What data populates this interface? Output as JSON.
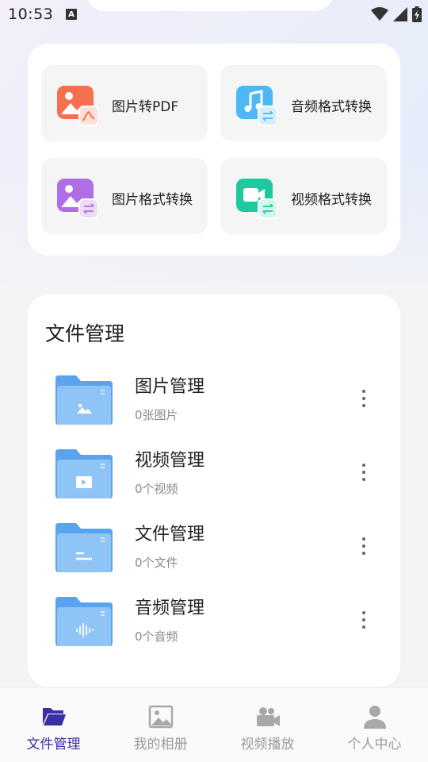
{
  "status_bar": {
    "time": "10:53",
    "notification_badge": "A"
  },
  "colors": {
    "active": "#3a2fa0",
    "inactive": "#a8a8a8",
    "folder_light": "#8fc4f7",
    "folder_dark": "#5aa3ee"
  },
  "tools": [
    {
      "label": "图片转PDF",
      "icon": "image-to-pdf-icon"
    },
    {
      "label": "音频格式转换",
      "icon": "audio-convert-icon"
    },
    {
      "label": "图片格式转换",
      "icon": "image-convert-icon"
    },
    {
      "label": "视频格式转换",
      "icon": "video-convert-icon"
    }
  ],
  "file_section": {
    "title": "文件管理",
    "items": [
      {
        "name": "图片管理",
        "sub": "0张图片",
        "icon": "image-folder-icon"
      },
      {
        "name": "视频管理",
        "sub": "0个视频",
        "icon": "video-folder-icon"
      },
      {
        "name": "文件管理",
        "sub": "0个文件",
        "icon": "document-folder-icon"
      },
      {
        "name": "音频管理",
        "sub": "0个音频",
        "icon": "audio-folder-icon"
      }
    ]
  },
  "bottom_nav": [
    {
      "label": "文件管理",
      "active": true,
      "icon": "folder-icon"
    },
    {
      "label": "我的相册",
      "active": false,
      "icon": "photo-icon"
    },
    {
      "label": "视频播放",
      "active": false,
      "icon": "video-camera-icon"
    },
    {
      "label": "个人中心",
      "active": false,
      "icon": "person-icon"
    }
  ]
}
